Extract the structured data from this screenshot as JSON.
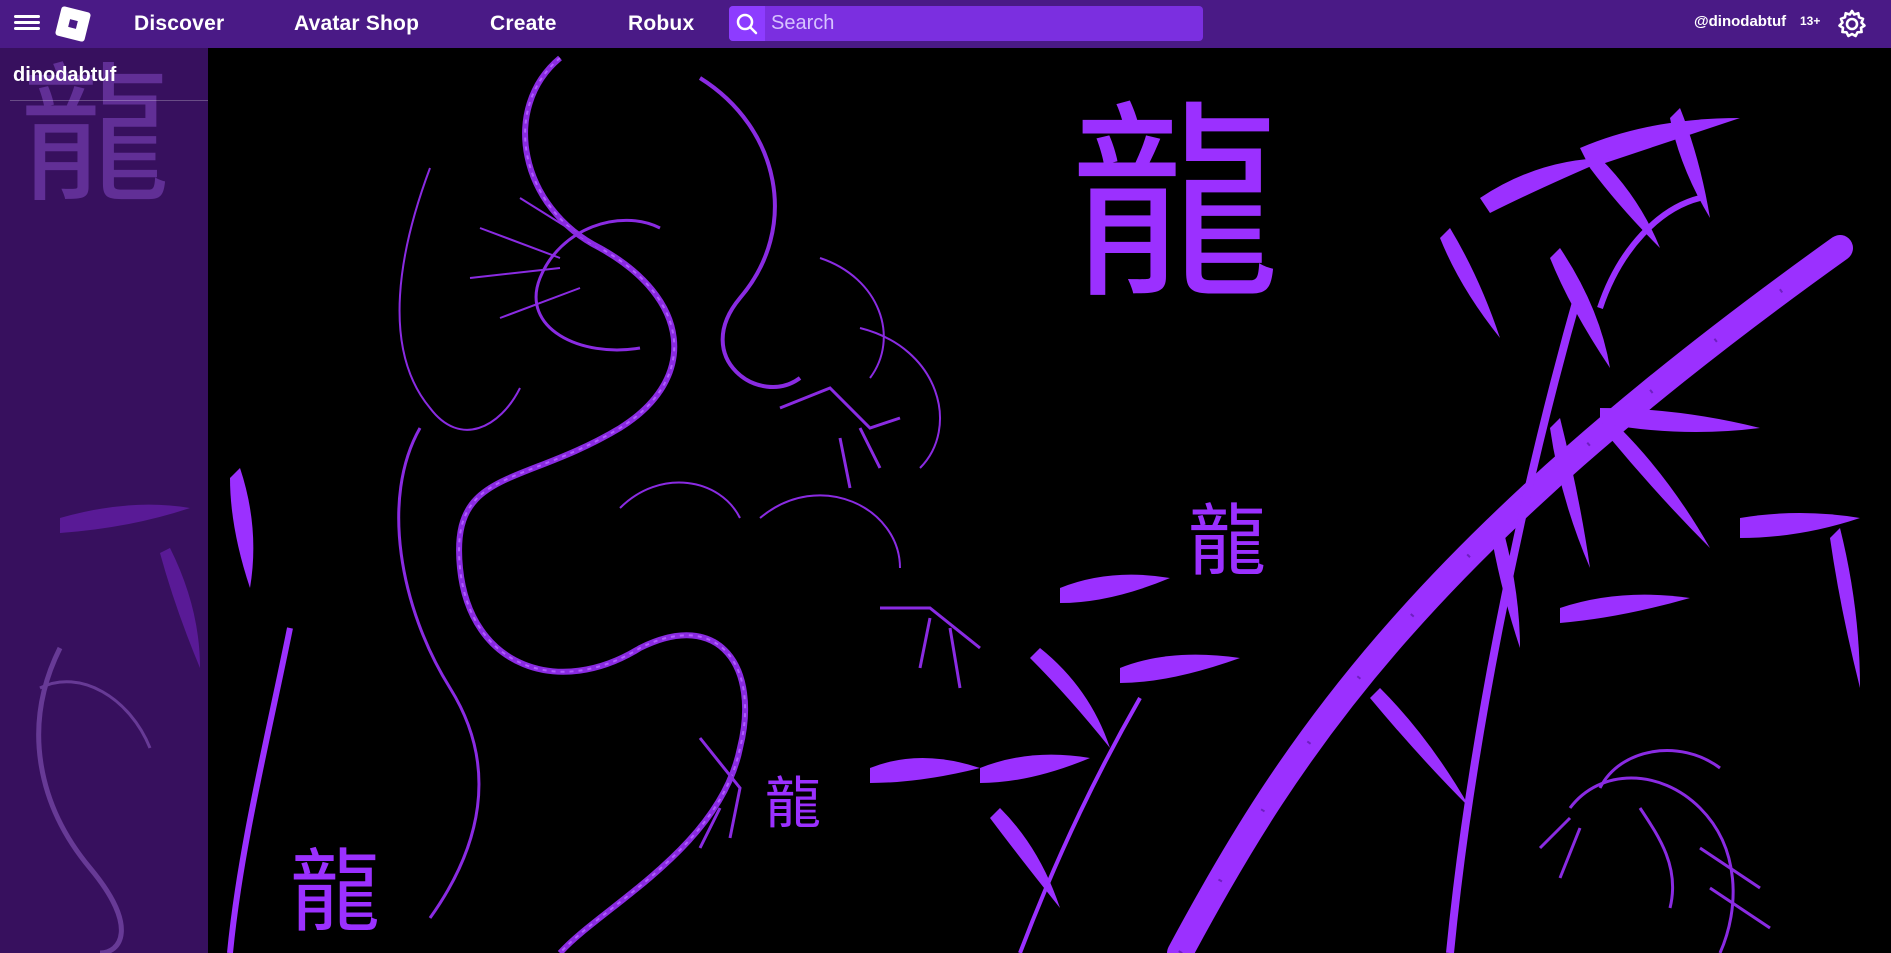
{
  "nav": {
    "links": [
      "Discover",
      "Avatar Shop",
      "Create",
      "Robux"
    ],
    "search_placeholder": "Search",
    "username_handle": "@dinodabtuf",
    "age_badge": "13+"
  },
  "sidebar": {
    "username": "dinodabtuf"
  },
  "icons": {
    "menu": "hamburger-menu-icon",
    "logo": "roblox-logo-icon",
    "search": "search-icon",
    "settings": "gear-icon"
  },
  "wallpaper": {
    "kanji": "龍"
  },
  "colors": {
    "topbar": "#4a1a86",
    "search_field": "#7b2fe0",
    "art_purple": "#8a2be2",
    "background": "#000000"
  }
}
